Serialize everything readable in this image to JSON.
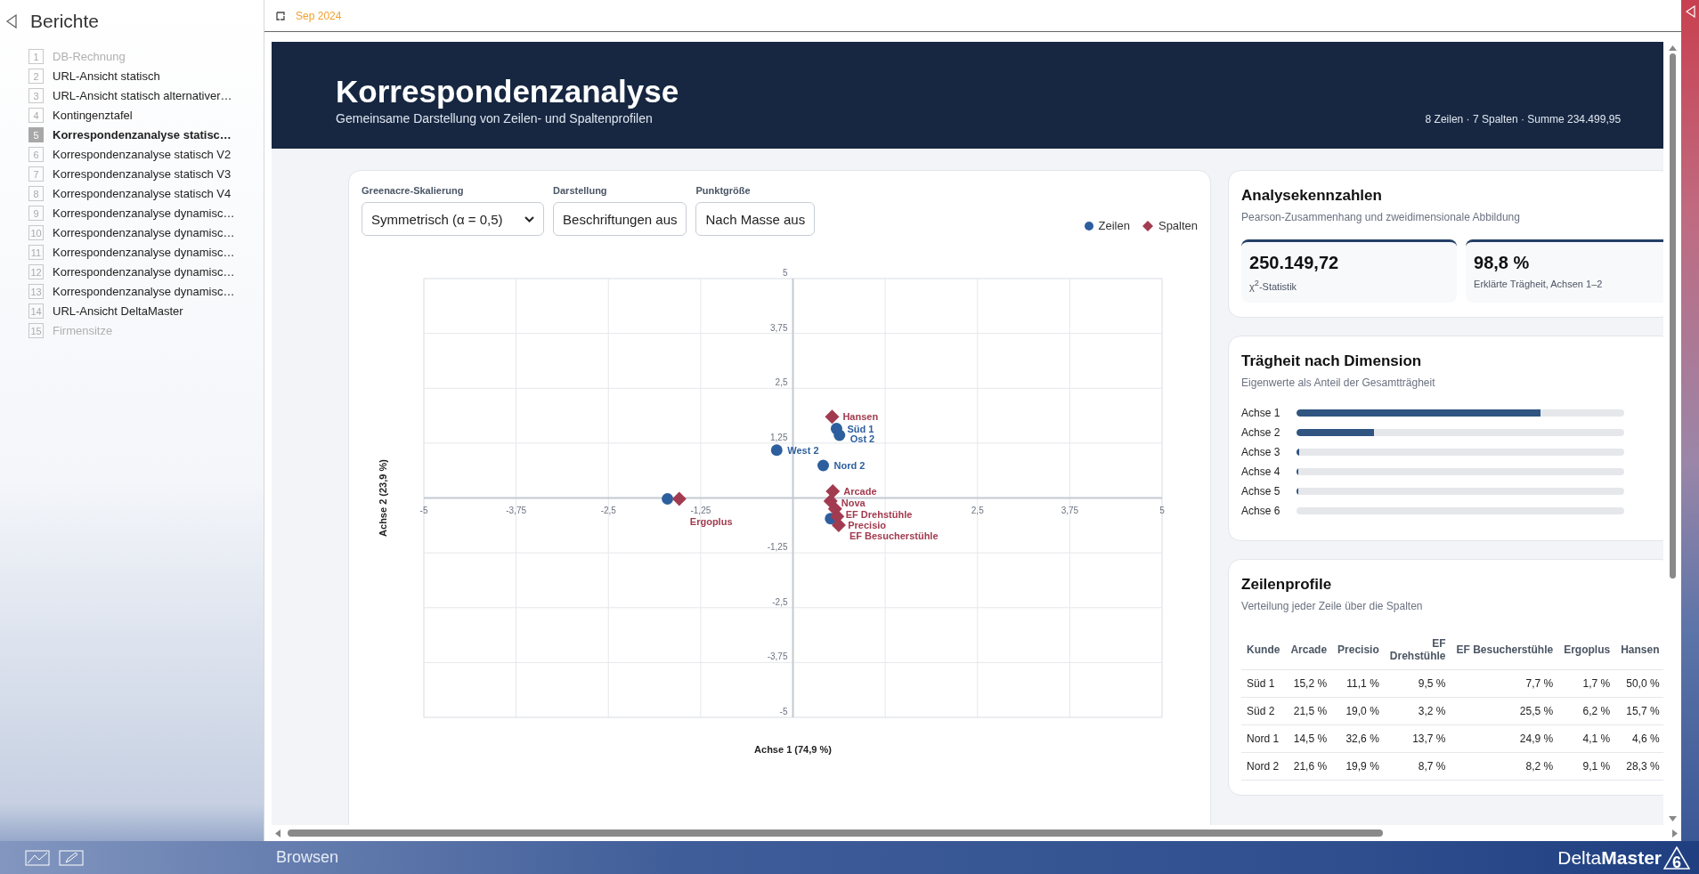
{
  "sidebar": {
    "title": "Berichte",
    "items": [
      {
        "number": "1",
        "label": "DB-Rechnung",
        "selected": false,
        "disabled": true
      },
      {
        "number": "2",
        "label": "URL-Ansicht statisch",
        "selected": false,
        "disabled": false
      },
      {
        "number": "3",
        "label": "URL-Ansicht statisch alternativer…",
        "selected": false,
        "disabled": false
      },
      {
        "number": "4",
        "label": "Kontingenztafel",
        "selected": false,
        "disabled": false
      },
      {
        "number": "5",
        "label": "Korrespondenzanalyse  statisc…",
        "selected": true,
        "disabled": false
      },
      {
        "number": "6",
        "label": "Korrespondenzanalyse statisch V2",
        "selected": false,
        "disabled": false
      },
      {
        "number": "7",
        "label": "Korrespondenzanalyse statisch V3",
        "selected": false,
        "disabled": false
      },
      {
        "number": "8",
        "label": "Korrespondenzanalyse statisch V4",
        "selected": false,
        "disabled": false
      },
      {
        "number": "9",
        "label": "Korrespondenzanalyse dynamisc…",
        "selected": false,
        "disabled": false
      },
      {
        "number": "10",
        "label": "Korrespondenzanalyse dynamisc…",
        "selected": false,
        "disabled": false
      },
      {
        "number": "11",
        "label": "Korrespondenzanalyse dynamisc…",
        "selected": false,
        "disabled": false
      },
      {
        "number": "12",
        "label": "Korrespondenzanalyse dynamisc…",
        "selected": false,
        "disabled": false
      },
      {
        "number": "13",
        "label": "Korrespondenzanalyse dynamisc…",
        "selected": false,
        "disabled": false
      },
      {
        "number": "14",
        "label": "URL-Ansicht DeltaMaster",
        "selected": false,
        "disabled": false
      },
      {
        "number": "15",
        "label": "Firmensitze",
        "selected": false,
        "disabled": true
      }
    ]
  },
  "toolbar": {
    "period": "Sep 2024"
  },
  "header": {
    "title": "Korrespondenzanalyse",
    "subtitle": "Gemeinsame Darstellung von Zeilen- und Spaltenprofilen",
    "summary": "8 Zeilen · 7 Spalten · Summe 234.499,95"
  },
  "controls": [
    {
      "label": "Greenacre-Skalierung",
      "kind": "select",
      "value": "Symmetrisch (α = 0,5)"
    },
    {
      "label": "Darstellung",
      "kind": "button",
      "value": "Beschriftungen aus"
    },
    {
      "label": "Punktgröße",
      "kind": "button",
      "value": "Nach Masse aus"
    }
  ],
  "chart_data": {
    "type": "scatter",
    "grid": true,
    "xlabel": "Achse 1 (74,9 %)",
    "ylabel": "Achse 2 (23,9 %)",
    "xlim": [
      -5,
      5
    ],
    "ylim": [
      -5,
      5
    ],
    "xticks": [
      {
        "value": -5,
        "label": "-5"
      },
      {
        "value": -3.75,
        "label": "-3,75"
      },
      {
        "value": -2.5,
        "label": "-2,5"
      },
      {
        "value": -1.25,
        "label": "-1,25"
      },
      {
        "value": 2.5,
        "label": "2,5"
      },
      {
        "value": 3.75,
        "label": "3,75"
      },
      {
        "value": 5,
        "label": "5"
      }
    ],
    "yticks": [
      {
        "value": 5,
        "label": "5"
      },
      {
        "value": 3.75,
        "label": "3,75"
      },
      {
        "value": 2.5,
        "label": "2,5"
      },
      {
        "value": 1.25,
        "label": "1,25"
      },
      {
        "value": -1.25,
        "label": "-1,25"
      },
      {
        "value": -2.5,
        "label": "-2,5"
      },
      {
        "value": -3.75,
        "label": "-3,75"
      },
      {
        "value": -5,
        "label": "-5"
      }
    ],
    "series": [
      {
        "name": "Zeilen",
        "marker": "circle",
        "color": "#2d5f9e",
        "x": [
          0.59,
          0.63,
          -0.22,
          0.41,
          -1.7,
          null,
          0.51
        ],
        "values": [
          1.58,
          1.43,
          1.09,
          0.74,
          -0.02,
          null,
          -0.47
        ]
      },
      {
        "name": "Spalten",
        "marker": "diamond",
        "color": "#a23b4f",
        "x": [
          0.53,
          -1.54,
          0.54,
          0.51,
          0.57,
          0.6,
          0.62
        ],
        "values": [
          1.85,
          -0.02,
          0.15,
          -0.07,
          -0.25,
          -0.42,
          -0.62
        ]
      }
    ],
    "annotations": [
      {
        "text": "Hansen",
        "x": 0.53,
        "y": 1.85
      },
      {
        "text": "Süd 1",
        "x": 0.59,
        "y": 1.58
      },
      {
        "text": "Ost 2",
        "x": 0.63,
        "y": 1.43
      },
      {
        "text": "West 2",
        "x": -0.22,
        "y": 1.09
      },
      {
        "text": "Nord 2",
        "x": 0.41,
        "y": 0.74
      },
      {
        "text": "Ergoplus",
        "x": -1.54,
        "y": -0.02
      },
      {
        "text": "Arcade",
        "x": 0.54,
        "y": 0.15
      },
      {
        "text": "Nova",
        "x": 0.51,
        "y": -0.07
      },
      {
        "text": "EF Drehstühle",
        "x": 0.57,
        "y": -0.25
      },
      {
        "text": "Precisio",
        "x": 0.6,
        "y": -0.42
      },
      {
        "text": "EF Besucherstühle",
        "x": 0.62,
        "y": -0.62
      }
    ]
  },
  "kpis": {
    "title": "Analysekennzahlen",
    "subtitle": "Pearson-Zusammenhang und zweidimensionale Abbildung",
    "items": [
      {
        "value": "250.149,72",
        "label": "χ$^{2}$-Statistik"
      },
      {
        "value": "98,8 %",
        "label": "Erklärte Trägheit, Achsen 1–2"
      }
    ]
  },
  "inertia": {
    "title": "Trägheit nach Dimension",
    "subtitle": "Eigenwerte als Anteil der Gesamtträgheit",
    "axes": [
      {
        "label": "Achse 1",
        "level": 0.745
      },
      {
        "label": "Achse 2",
        "level": 0.235
      },
      {
        "label": "Achse 3",
        "level": 0.008
      },
      {
        "label": "Achse 4",
        "level": 0.005
      },
      {
        "label": "Achse 5",
        "level": 0.005
      },
      {
        "label": "Achse 6"
      }
    ]
  },
  "row_profiles": {
    "title": "Zeilenprofile",
    "subtitle": "Verteilung jeder Zeile über die Spalten",
    "columns": [
      "Kunde",
      "Arcade",
      "Precisio",
      "EF Drehstühle",
      "EF Besucherstühle",
      "Ergoplus",
      "Hansen"
    ],
    "rows": [
      [
        "Süd 1",
        "15,2 %",
        "11,1 %",
        "9,5 %",
        "7,7 %",
        "1,7 %",
        "50,0 %"
      ],
      [
        "Süd 2",
        "21,5 %",
        "19,0 %",
        "3,2 %",
        "25,5 %",
        "6,2 %",
        "15,7 %"
      ],
      [
        "Nord 1",
        "14,5 %",
        "32,6 %",
        "13,7 %",
        "24,9 %",
        "4,1 %",
        "4,6 %"
      ],
      [
        "Nord 2",
        "21,6 %",
        "19,9 %",
        "8,7 %",
        "8,2 %",
        "9,1 %",
        "28,3 %"
      ]
    ]
  },
  "footer": {
    "mode": "Browsen",
    "brand": "Delta**Master**",
    "version": "6"
  }
}
